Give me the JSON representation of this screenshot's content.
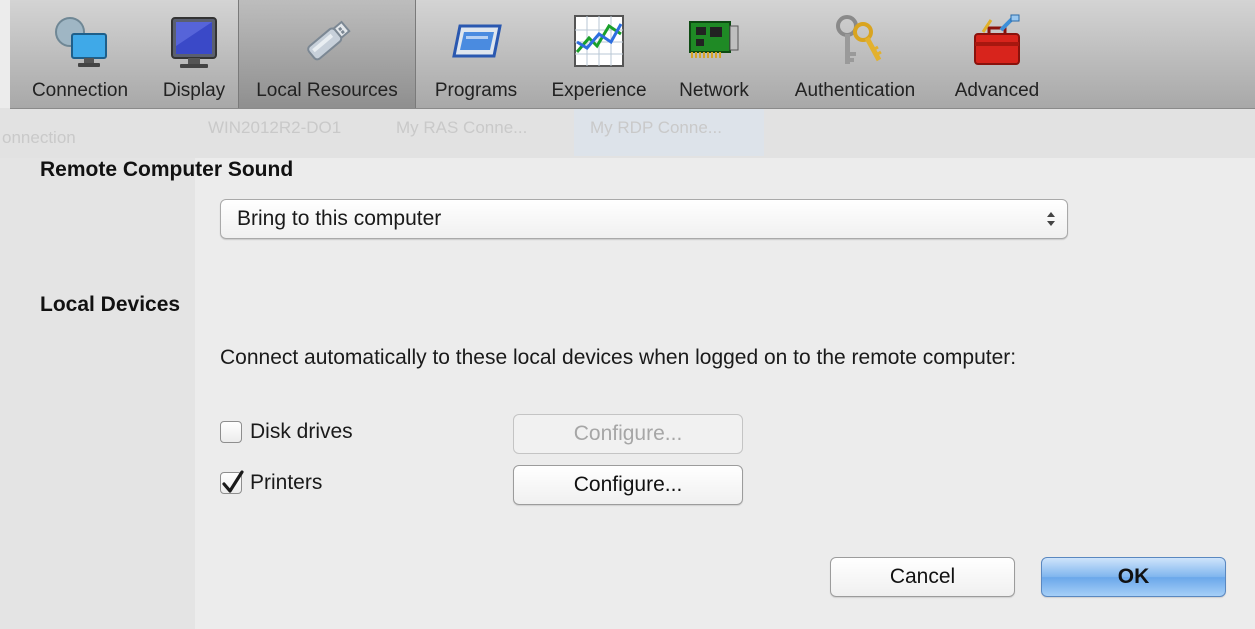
{
  "toolbar": {
    "tabs": [
      {
        "label": "Connection",
        "icon": "monitor-network-icon"
      },
      {
        "label": "Display",
        "icon": "display-monitor-icon"
      },
      {
        "label": "Local Resources",
        "icon": "usb-drive-icon",
        "selected": true
      },
      {
        "label": "Programs",
        "icon": "program-window-icon"
      },
      {
        "label": "Experience",
        "icon": "performance-chart-icon"
      },
      {
        "label": "Network",
        "icon": "network-card-icon"
      },
      {
        "label": "Authentication",
        "icon": "keys-icon"
      },
      {
        "label": "Advanced",
        "icon": "toolbox-icon"
      }
    ]
  },
  "background_ghost": {
    "sidebar_text": "onnection",
    "items": [
      "WIN2012R2-DO1",
      "My RAS Conne...",
      "My RDP Conne..."
    ]
  },
  "remote_sound": {
    "title": "Remote Computer Sound",
    "selected_option": "Bring to this computer"
  },
  "local_devices": {
    "title": "Local Devices",
    "description": "Connect automatically to these local devices when logged on to the remote computer:",
    "devices": [
      {
        "label": "Disk drives",
        "checked": false,
        "configure_label": "Configure...",
        "configure_enabled": false
      },
      {
        "label": "Printers",
        "checked": true,
        "configure_label": "Configure...",
        "configure_enabled": true
      }
    ]
  },
  "footer": {
    "cancel_label": "Cancel",
    "ok_label": "OK"
  },
  "colors": {
    "accent": "#6aa7ea",
    "toolbar_top": "#d4d4d4",
    "toolbar_bottom": "#a8a8a8",
    "background": "#ececec"
  }
}
